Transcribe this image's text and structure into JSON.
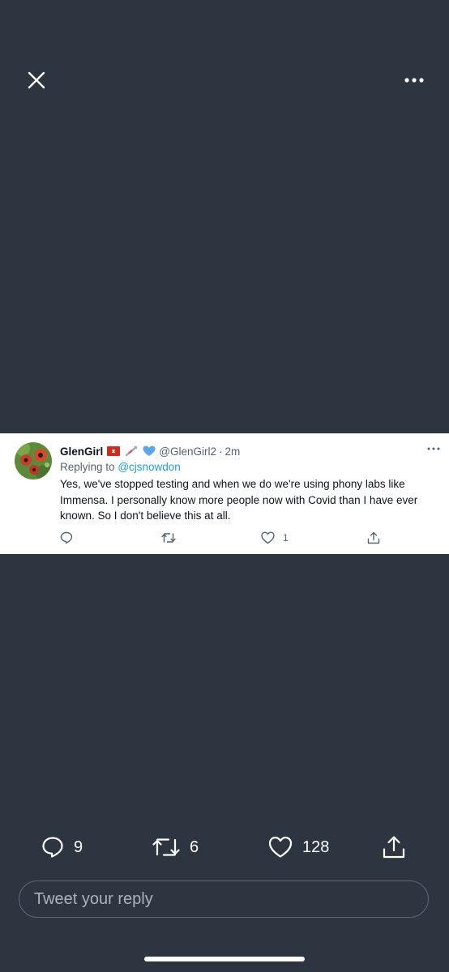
{
  "viewer": {
    "close_icon": "close-icon",
    "more_icon": "more-horizontal-icon"
  },
  "tweet": {
    "avatar_icon": "poppy-avatar",
    "display_name": "GlenGirl",
    "badges": [
      "flag-icon",
      "syringe-icon",
      "blue-heart-icon"
    ],
    "handle": "@GlenGirl2",
    "separator": "·",
    "time": "2m",
    "replying_prefix": "Replying to",
    "replying_to": "@cjsnowdon",
    "text": "Yes, we've stopped testing and when we do we're using phony labs like Immensa. I personally know more people now with Covid than I have ever known. So I don't believe this at all.",
    "actions": {
      "reply_count": "",
      "retweet_count": "",
      "like_count": "1",
      "share_icon": "share-icon"
    }
  },
  "stats": {
    "replies": "9",
    "retweets": "6",
    "likes": "128",
    "share_icon": "share-icon"
  },
  "reply_box": {
    "placeholder": "Tweet your reply"
  },
  "colors": {
    "background": "#2c3540",
    "accent": "#1d9bf0",
    "card": "#ffffff"
  }
}
